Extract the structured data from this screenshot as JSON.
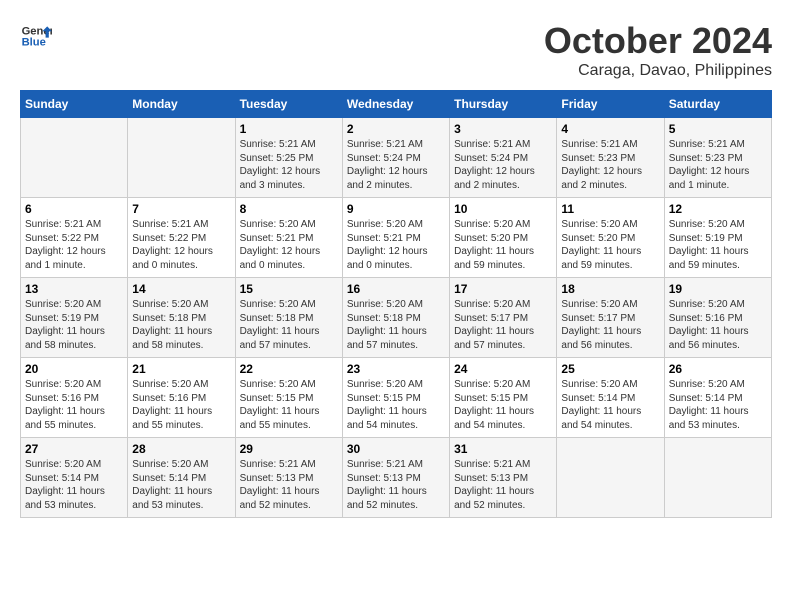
{
  "header": {
    "logo_line1": "General",
    "logo_line2": "Blue",
    "month": "October 2024",
    "location": "Caraga, Davao, Philippines"
  },
  "days_of_week": [
    "Sunday",
    "Monday",
    "Tuesday",
    "Wednesday",
    "Thursday",
    "Friday",
    "Saturday"
  ],
  "weeks": [
    [
      {
        "num": "",
        "detail": ""
      },
      {
        "num": "",
        "detail": ""
      },
      {
        "num": "1",
        "detail": "Sunrise: 5:21 AM\nSunset: 5:25 PM\nDaylight: 12 hours\nand 3 minutes."
      },
      {
        "num": "2",
        "detail": "Sunrise: 5:21 AM\nSunset: 5:24 PM\nDaylight: 12 hours\nand 2 minutes."
      },
      {
        "num": "3",
        "detail": "Sunrise: 5:21 AM\nSunset: 5:24 PM\nDaylight: 12 hours\nand 2 minutes."
      },
      {
        "num": "4",
        "detail": "Sunrise: 5:21 AM\nSunset: 5:23 PM\nDaylight: 12 hours\nand 2 minutes."
      },
      {
        "num": "5",
        "detail": "Sunrise: 5:21 AM\nSunset: 5:23 PM\nDaylight: 12 hours\nand 1 minute."
      }
    ],
    [
      {
        "num": "6",
        "detail": "Sunrise: 5:21 AM\nSunset: 5:22 PM\nDaylight: 12 hours\nand 1 minute."
      },
      {
        "num": "7",
        "detail": "Sunrise: 5:21 AM\nSunset: 5:22 PM\nDaylight: 12 hours\nand 0 minutes."
      },
      {
        "num": "8",
        "detail": "Sunrise: 5:20 AM\nSunset: 5:21 PM\nDaylight: 12 hours\nand 0 minutes."
      },
      {
        "num": "9",
        "detail": "Sunrise: 5:20 AM\nSunset: 5:21 PM\nDaylight: 12 hours\nand 0 minutes."
      },
      {
        "num": "10",
        "detail": "Sunrise: 5:20 AM\nSunset: 5:20 PM\nDaylight: 11 hours\nand 59 minutes."
      },
      {
        "num": "11",
        "detail": "Sunrise: 5:20 AM\nSunset: 5:20 PM\nDaylight: 11 hours\nand 59 minutes."
      },
      {
        "num": "12",
        "detail": "Sunrise: 5:20 AM\nSunset: 5:19 PM\nDaylight: 11 hours\nand 59 minutes."
      }
    ],
    [
      {
        "num": "13",
        "detail": "Sunrise: 5:20 AM\nSunset: 5:19 PM\nDaylight: 11 hours\nand 58 minutes."
      },
      {
        "num": "14",
        "detail": "Sunrise: 5:20 AM\nSunset: 5:18 PM\nDaylight: 11 hours\nand 58 minutes."
      },
      {
        "num": "15",
        "detail": "Sunrise: 5:20 AM\nSunset: 5:18 PM\nDaylight: 11 hours\nand 57 minutes."
      },
      {
        "num": "16",
        "detail": "Sunrise: 5:20 AM\nSunset: 5:18 PM\nDaylight: 11 hours\nand 57 minutes."
      },
      {
        "num": "17",
        "detail": "Sunrise: 5:20 AM\nSunset: 5:17 PM\nDaylight: 11 hours\nand 57 minutes."
      },
      {
        "num": "18",
        "detail": "Sunrise: 5:20 AM\nSunset: 5:17 PM\nDaylight: 11 hours\nand 56 minutes."
      },
      {
        "num": "19",
        "detail": "Sunrise: 5:20 AM\nSunset: 5:16 PM\nDaylight: 11 hours\nand 56 minutes."
      }
    ],
    [
      {
        "num": "20",
        "detail": "Sunrise: 5:20 AM\nSunset: 5:16 PM\nDaylight: 11 hours\nand 55 minutes."
      },
      {
        "num": "21",
        "detail": "Sunrise: 5:20 AM\nSunset: 5:16 PM\nDaylight: 11 hours\nand 55 minutes."
      },
      {
        "num": "22",
        "detail": "Sunrise: 5:20 AM\nSunset: 5:15 PM\nDaylight: 11 hours\nand 55 minutes."
      },
      {
        "num": "23",
        "detail": "Sunrise: 5:20 AM\nSunset: 5:15 PM\nDaylight: 11 hours\nand 54 minutes."
      },
      {
        "num": "24",
        "detail": "Sunrise: 5:20 AM\nSunset: 5:15 PM\nDaylight: 11 hours\nand 54 minutes."
      },
      {
        "num": "25",
        "detail": "Sunrise: 5:20 AM\nSunset: 5:14 PM\nDaylight: 11 hours\nand 54 minutes."
      },
      {
        "num": "26",
        "detail": "Sunrise: 5:20 AM\nSunset: 5:14 PM\nDaylight: 11 hours\nand 53 minutes."
      }
    ],
    [
      {
        "num": "27",
        "detail": "Sunrise: 5:20 AM\nSunset: 5:14 PM\nDaylight: 11 hours\nand 53 minutes."
      },
      {
        "num": "28",
        "detail": "Sunrise: 5:20 AM\nSunset: 5:14 PM\nDaylight: 11 hours\nand 53 minutes."
      },
      {
        "num": "29",
        "detail": "Sunrise: 5:21 AM\nSunset: 5:13 PM\nDaylight: 11 hours\nand 52 minutes."
      },
      {
        "num": "30",
        "detail": "Sunrise: 5:21 AM\nSunset: 5:13 PM\nDaylight: 11 hours\nand 52 minutes."
      },
      {
        "num": "31",
        "detail": "Sunrise: 5:21 AM\nSunset: 5:13 PM\nDaylight: 11 hours\nand 52 minutes."
      },
      {
        "num": "",
        "detail": ""
      },
      {
        "num": "",
        "detail": ""
      }
    ]
  ]
}
